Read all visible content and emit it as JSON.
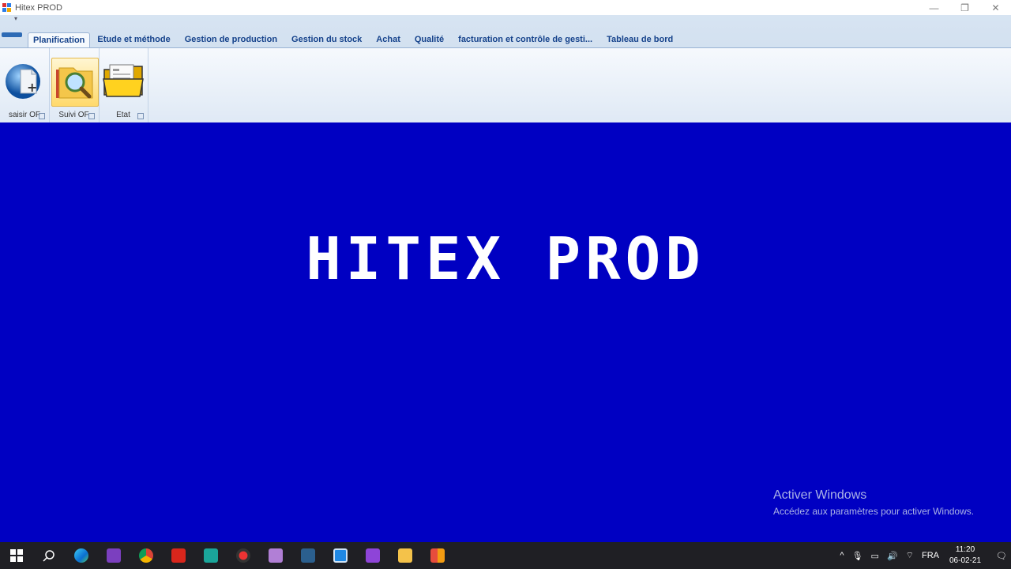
{
  "window": {
    "title": "Hitex PROD",
    "minimize": "—",
    "maximize": "❐",
    "close": "✕"
  },
  "ribbon": {
    "qat_arrow": "▾",
    "tabs": [
      {
        "label": "Planification",
        "active": true
      },
      {
        "label": "Etude et méthode"
      },
      {
        "label": "Gestion de production"
      },
      {
        "label": "Gestion du stock"
      },
      {
        "label": "Achat"
      },
      {
        "label": "Qualité"
      },
      {
        "label": "facturation et contrôle de gesti..."
      },
      {
        "label": "Tableau de bord"
      }
    ],
    "groups": [
      {
        "label": "saisir OF",
        "icon": "new-document-icon"
      },
      {
        "label": "Suivi OF",
        "icon": "folder-search-icon"
      },
      {
        "label": "Etat",
        "icon": "folder-report-icon"
      }
    ]
  },
  "main": {
    "banner": "HITEX PROD",
    "activation_title": "Activer Windows",
    "activation_sub": "Accédez aux paramètres pour activer Windows."
  },
  "taskbar": {
    "apps": [
      "windows-start-icon",
      "search-icon",
      "edge-icon",
      "visual-studio-icon",
      "chrome-icon",
      "pdf-icon",
      "camera-icon",
      "record-icon",
      "pen-app-icon",
      "sql-icon",
      "app-window-icon",
      "visual-studio-icon",
      "file-explorer-icon",
      "app-icon"
    ],
    "tray": {
      "chevron": "^",
      "language": "FRA",
      "time": "11:20",
      "date": "06-02-21"
    }
  },
  "colors": {
    "main_bg": "#0000c2",
    "ribbon_tab_text": "#15428b",
    "taskbar_bg": "#1f1f24"
  }
}
